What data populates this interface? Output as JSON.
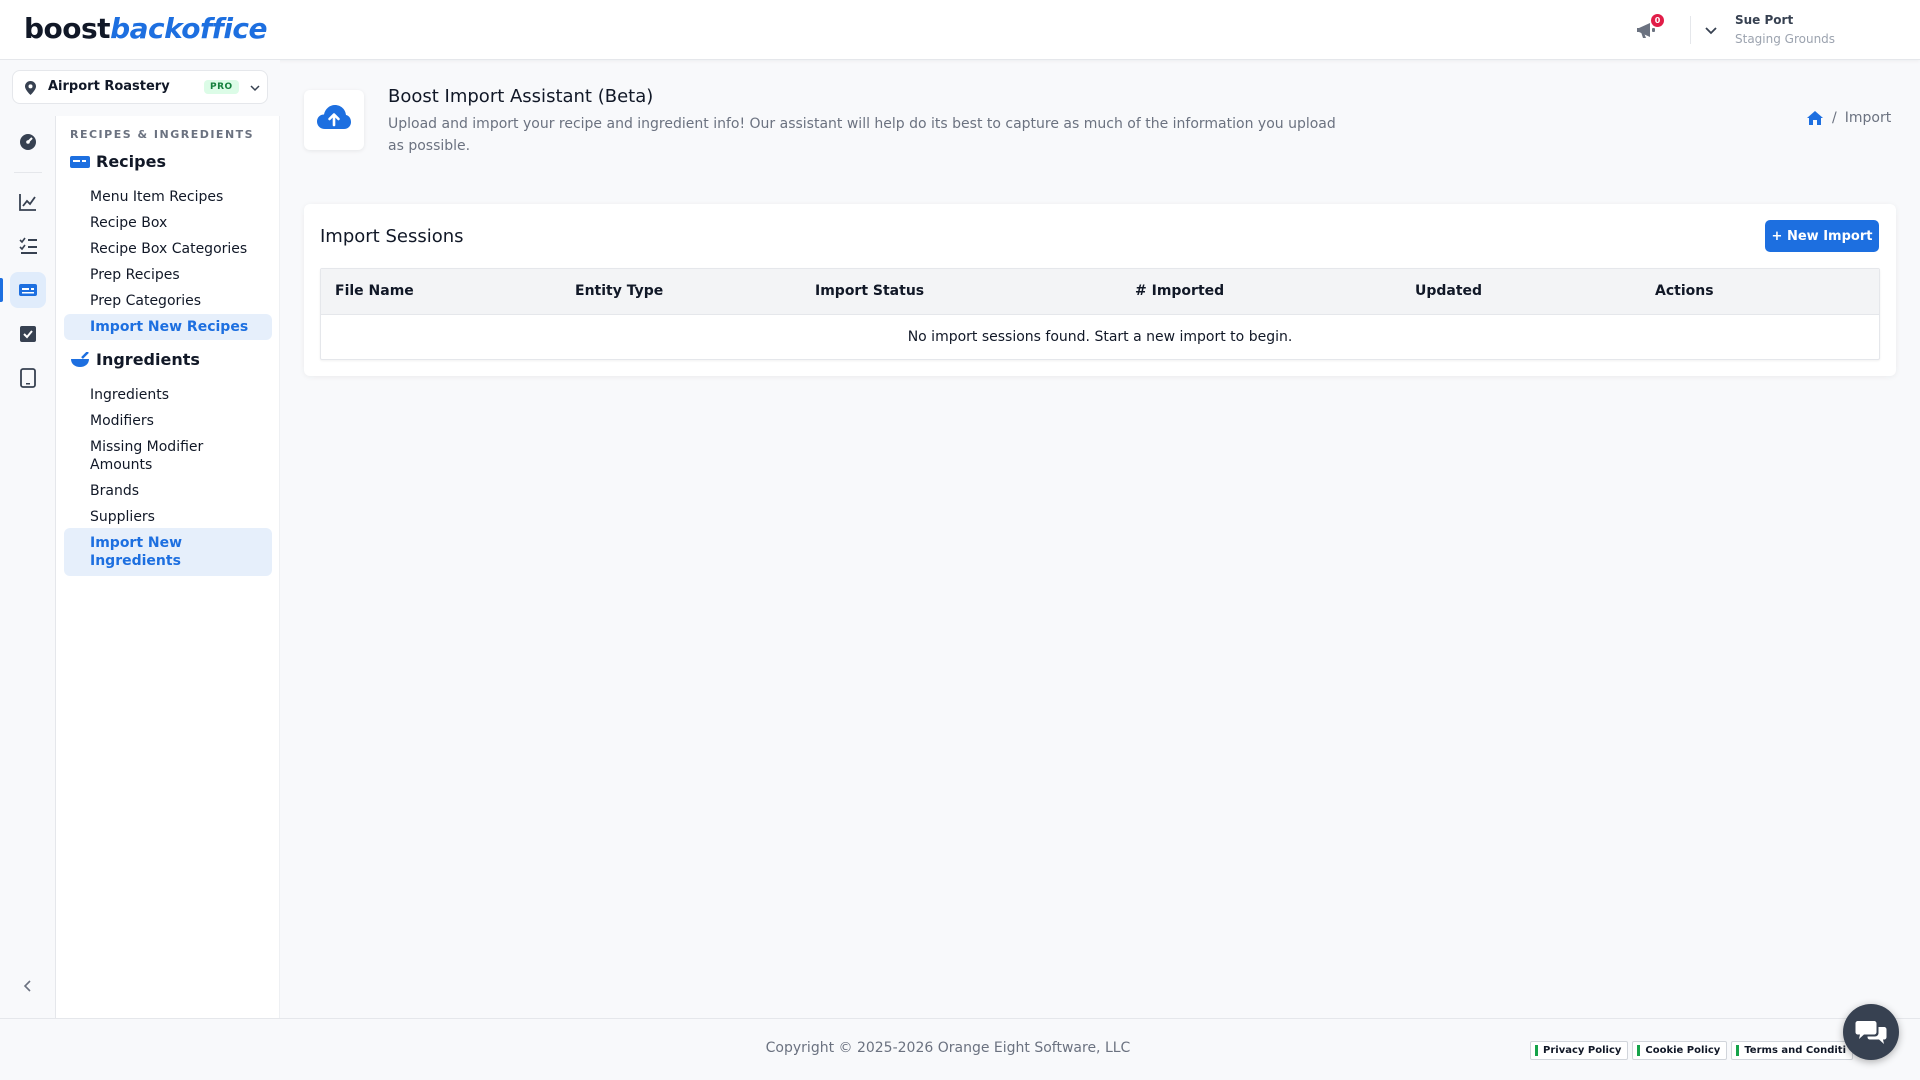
{
  "header": {
    "logo_part1": "boost",
    "logo_part2": "backoffice",
    "notification_count": "0",
    "user_name": "Sue Port",
    "user_org": "Staging Grounds"
  },
  "location": {
    "name": "Airport Roastery",
    "badge": "PRO"
  },
  "sidebar": {
    "section_label": "RECIPES & INGREDIENTS",
    "recipes": {
      "title": "Recipes",
      "items": [
        "Menu Item Recipes",
        "Recipe Box",
        "Recipe Box Categories",
        "Prep Recipes",
        "Prep Categories",
        "Import New Recipes"
      ]
    },
    "ingredients": {
      "title": "Ingredients",
      "items": [
        "Ingredients",
        "Modifiers",
        "Missing Modifier Amounts",
        "Brands",
        "Suppliers",
        "Import New Ingredients"
      ]
    }
  },
  "page": {
    "title": "Boost Import Assistant (Beta)",
    "description": "Upload and import your recipe and ingredient info! Our assistant will help do its best to capture as much of the information you upload as possible.",
    "breadcrumb_current": "Import"
  },
  "import_sessions": {
    "title": "Import Sessions",
    "new_button": "+ New Import",
    "columns": [
      "File Name",
      "Entity Type",
      "Import Status",
      "# Imported",
      "Updated",
      "Actions"
    ],
    "empty_message": "No import sessions found. Start a new import to begin."
  },
  "footer": {
    "copyright": "Copyright © 2025-2026 Orange Eight Software, LLC",
    "links": [
      "Privacy Policy",
      "Cookie Policy",
      "Terms and Conditi"
    ]
  },
  "colors": {
    "accent": "#1d6fe0",
    "pro_badge": "#15803d",
    "notification": "#e11d48"
  }
}
